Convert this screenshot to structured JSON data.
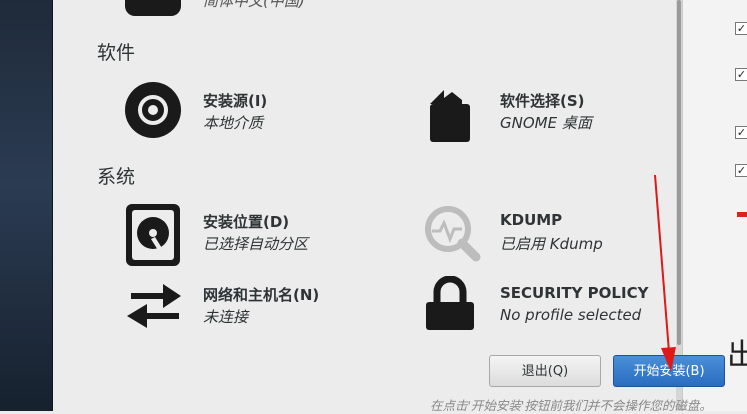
{
  "top_partial": {
    "status": "简体中文(中国)"
  },
  "sections": {
    "software": "软件",
    "system": "系统"
  },
  "spokes": {
    "install_source": {
      "title": "安装源(I)",
      "status": "本地介质",
      "icon": "disc-icon"
    },
    "software_selection": {
      "title": "软件选择(S)",
      "status": "GNOME 桌面",
      "icon": "package-icon"
    },
    "install_destination": {
      "title": "安装位置(D)",
      "status": "已选择自动分区",
      "icon": "harddisk-icon"
    },
    "kdump": {
      "title": "KDUMP",
      "status": "已启用 Kdump",
      "icon": "magnifier-icon"
    },
    "network": {
      "title": "网络和主机名(N)",
      "status": "未连接",
      "icon": "network-arrows-icon"
    },
    "security": {
      "title": "SECURITY POLICY",
      "status": "No profile selected",
      "icon": "padlock-icon"
    }
  },
  "buttons": {
    "quit": "退出(Q)",
    "begin_install": "开始安装(B)"
  },
  "footer_note": "在点击'开始安装'按钮前我们并不会操作您的磁盘。",
  "right_panel": {
    "char": "出"
  },
  "colors": {
    "accent_blue": "#2a6cbf",
    "annotation_red": "#e01818",
    "dark_icon": "#1a1a1a"
  }
}
